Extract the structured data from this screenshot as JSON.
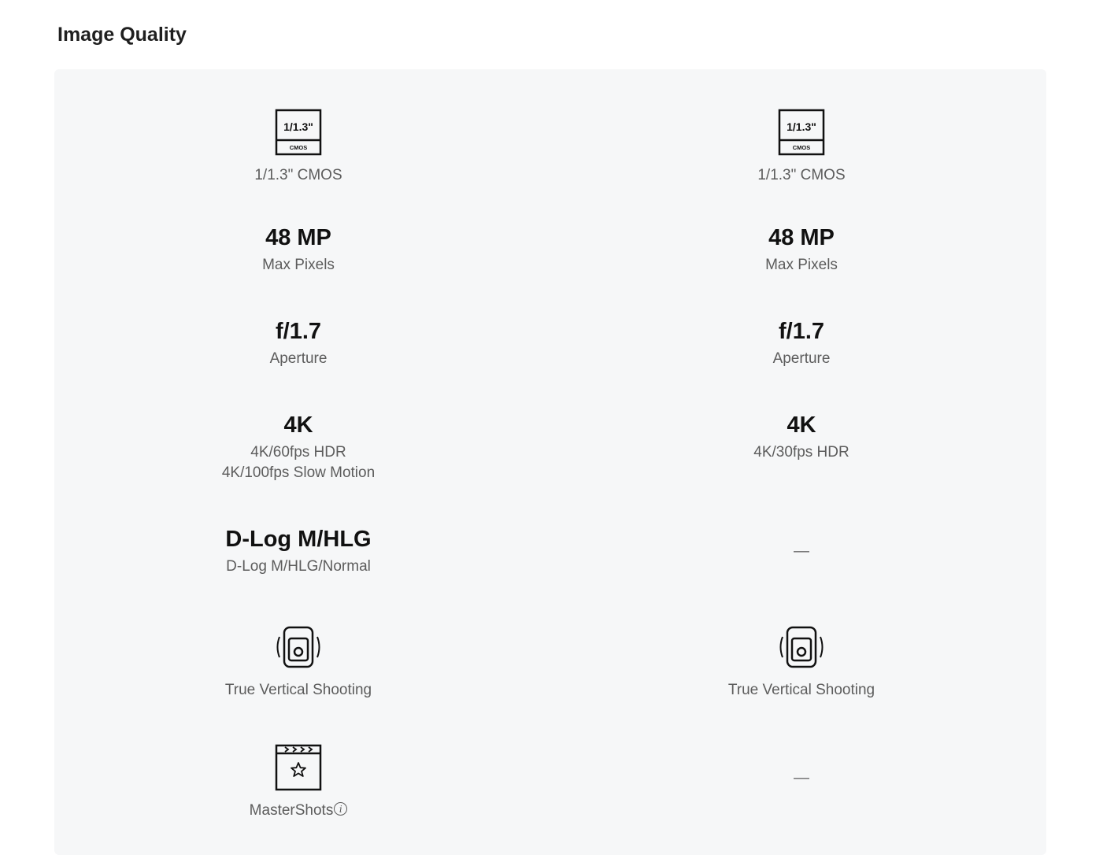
{
  "page": {
    "title": "Image Quality"
  },
  "left": {
    "sensor": {
      "icon_top": "1/1.3\"",
      "icon_bottom": "CMOS",
      "label": "1/1.3\" CMOS"
    },
    "pixels": {
      "value": "48 MP",
      "label": "Max Pixels"
    },
    "aperture": {
      "value": "f/1.7",
      "label": "Aperture"
    },
    "video": {
      "value": "4K",
      "line1": "4K/60fps HDR",
      "line2": "4K/100fps Slow Motion"
    },
    "color": {
      "value": "D-Log M/HLG",
      "label": "D-Log M/HLG/Normal"
    },
    "vertical": {
      "icon": "vertical-shooting-icon",
      "label": "True Vertical Shooting"
    },
    "mastershots": {
      "icon": "mastershots-icon",
      "label": "MasterShots",
      "info_icon": "info-icon"
    }
  },
  "right": {
    "sensor": {
      "icon_top": "1/1.3\"",
      "icon_bottom": "CMOS",
      "label": "1/1.3\" CMOS"
    },
    "pixels": {
      "value": "48 MP",
      "label": "Max Pixels"
    },
    "aperture": {
      "value": "f/1.7",
      "label": "Aperture"
    },
    "video": {
      "value": "4K",
      "line1": "4K/30fps HDR"
    },
    "color": {
      "dash": "—"
    },
    "vertical": {
      "icon": "vertical-shooting-icon",
      "label": "True Vertical Shooting"
    },
    "mastershots": {
      "dash": "—"
    }
  },
  "colors": {
    "panel_bg": "#f6f7f8",
    "text_primary": "#111111",
    "text_secondary": "#5c5c5c"
  }
}
